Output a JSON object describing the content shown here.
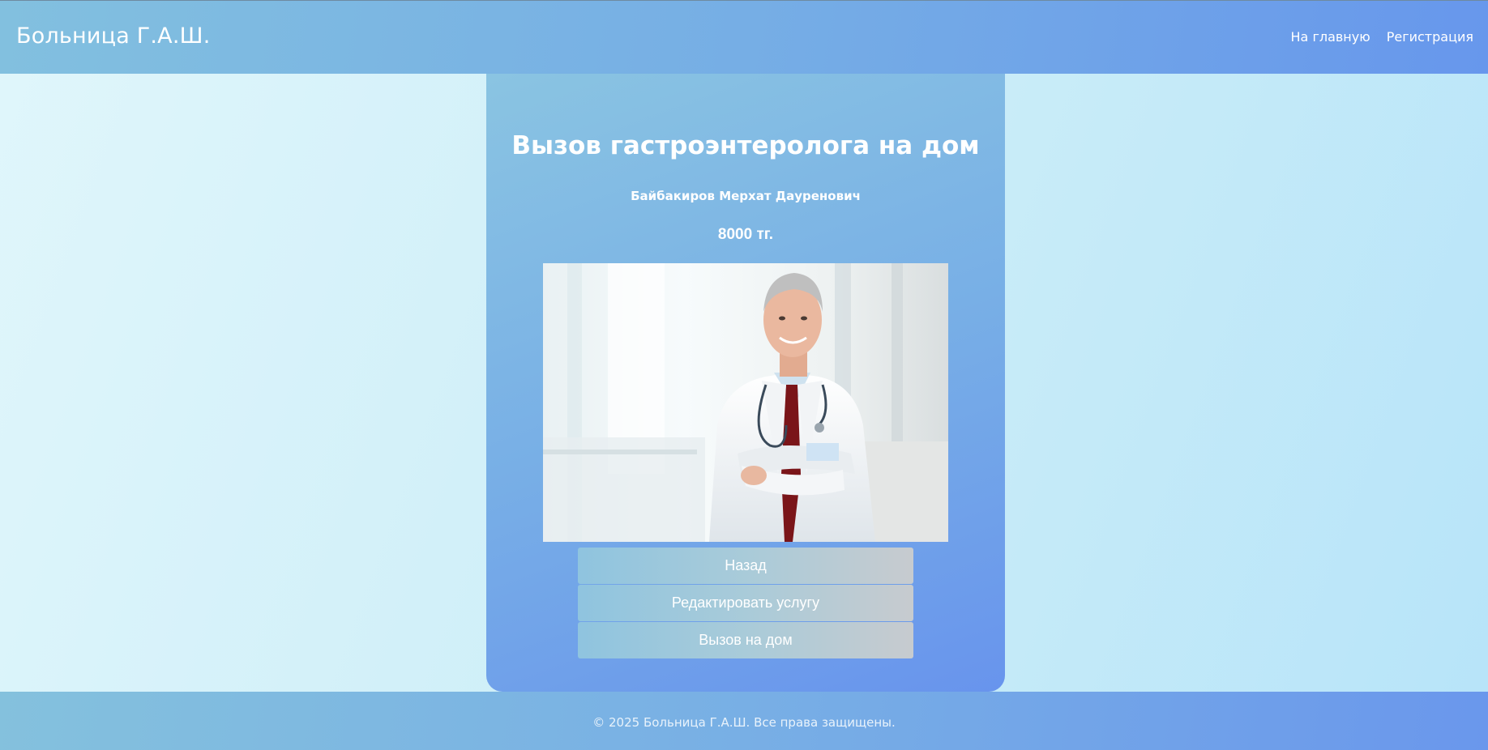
{
  "header": {
    "brand": "Больница Г.А.Ш.",
    "nav": [
      {
        "label": "На главную"
      },
      {
        "label": "Регистрация"
      }
    ]
  },
  "service": {
    "title": "Вызов гастроэнтеролога на дом",
    "doctor": "Байбакиров Мерхат Дауренович",
    "price": "8000 тг.",
    "photo_icon": "doctor-photo"
  },
  "actions": {
    "back_label": "Назад",
    "edit_label": "Редактировать услугу",
    "call_label": "Вызов на дом"
  },
  "footer": {
    "copyright": "© 2025 Больница Г.А.Ш. Все права защищены."
  },
  "colors": {
    "header_start": "#82c0df",
    "header_end": "#6797ec",
    "card_start": "#8ac4e2",
    "card_end": "#6894ed",
    "background": "#cdeef8"
  }
}
